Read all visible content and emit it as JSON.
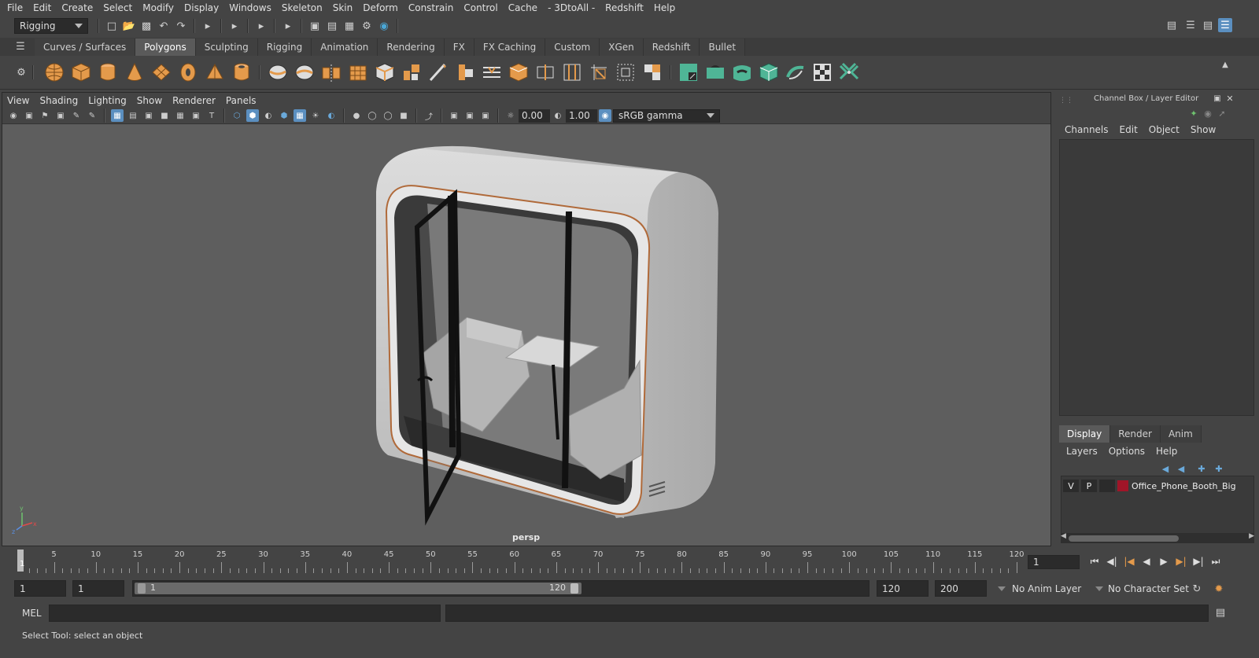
{
  "menu": [
    "File",
    "Edit",
    "Create",
    "Select",
    "Modify",
    "Display",
    "Windows",
    "Skeleton",
    "Skin",
    "Deform",
    "Constrain",
    "Control",
    "Cache",
    "- 3DtoAll -",
    "Redshift",
    "Help"
  ],
  "status_line": {
    "mode": "Rigging"
  },
  "shelf_tabs": [
    "Curves / Surfaces",
    "Polygons",
    "Sculpting",
    "Rigging",
    "Animation",
    "Rendering",
    "FX",
    "FX Caching",
    "Custom",
    "XGen",
    "Redshift",
    "Bullet"
  ],
  "shelf_active": "Polygons",
  "viewport": {
    "menu": [
      "View",
      "Shading",
      "Lighting",
      "Show",
      "Renderer",
      "Panels"
    ],
    "exposure": "0.00",
    "gamma": "1.00",
    "color_space": "sRGB gamma",
    "camera": "persp"
  },
  "channel_box": {
    "title": "Channel Box / Layer Editor",
    "menu": [
      "Channels",
      "Edit",
      "Object",
      "Show"
    ]
  },
  "layer_editor": {
    "tabs": [
      "Display",
      "Render",
      "Anim"
    ],
    "active_tab": "Display",
    "menu": [
      "Layers",
      "Options",
      "Help"
    ],
    "layers": [
      {
        "visible": "V",
        "playback": "P",
        "color": "#a01528",
        "name": "Office_Phone_Booth_Big"
      }
    ]
  },
  "time_slider": {
    "ticks": [
      "5",
      "10",
      "15",
      "20",
      "25",
      "30",
      "35",
      "40",
      "45",
      "50",
      "55",
      "60",
      "65",
      "70",
      "75",
      "80",
      "85",
      "90",
      "95",
      "100",
      "105",
      "110",
      "115",
      "120"
    ],
    "start_marker": "1",
    "current_frame": "1"
  },
  "range": {
    "start": "1",
    "anim_start": "1",
    "slider_start": "1",
    "slider_end": "120",
    "anim_end": "120",
    "end": "200",
    "anim_layer": "No Anim Layer",
    "character_set": "No Character Set"
  },
  "command_line": {
    "label": "MEL"
  },
  "status_message": "Select Tool: select an object",
  "colors": {
    "accent": "#5b8fc0",
    "shelf_orange": "#e49a4b",
    "shelf_green": "#4fb596"
  }
}
